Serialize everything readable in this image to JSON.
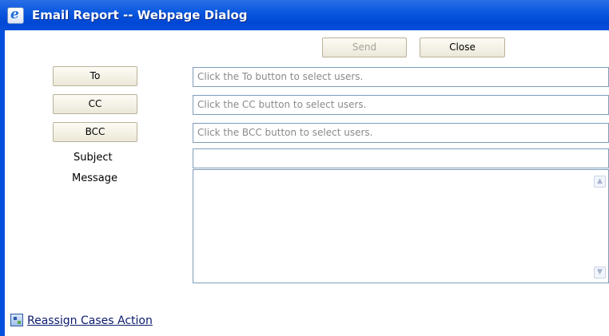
{
  "window": {
    "title": "Email Report -- Webpage Dialog",
    "icon": "ie-icon"
  },
  "toolbar": {
    "send_label": "Send",
    "close_label": "Close"
  },
  "recipients": {
    "to_label": "To",
    "to_placeholder": "Click the To button to select users.",
    "cc_label": "CC",
    "cc_placeholder": "Click the CC button to select users.",
    "bcc_label": "BCC",
    "bcc_placeholder": "Click the BCC button to select users."
  },
  "subject": {
    "label": "Subject",
    "value": ""
  },
  "message": {
    "label": "Message",
    "value": ""
  },
  "footer": {
    "link_label": "Reassign Cases Action",
    "link_icon": "report-icon"
  }
}
